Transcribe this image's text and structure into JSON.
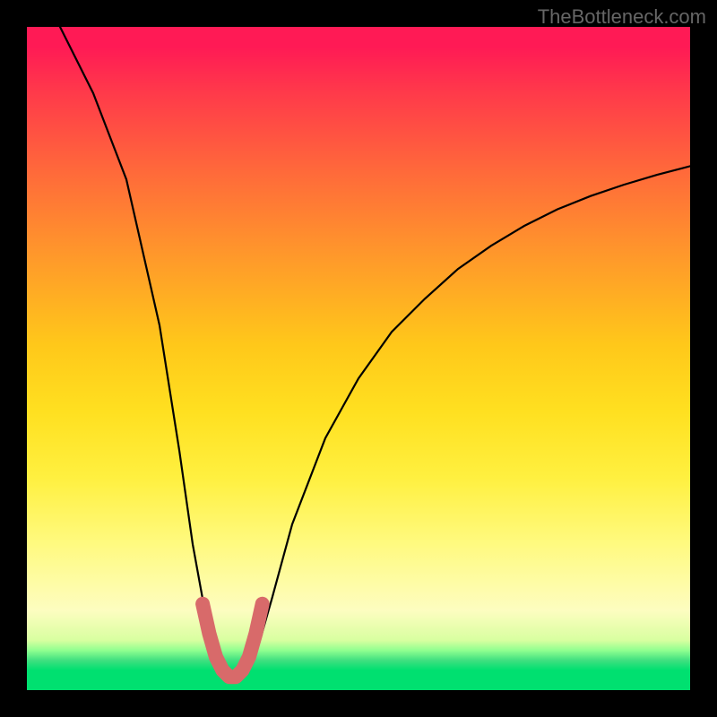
{
  "watermark": "TheBottleneck.com",
  "chart_data": {
    "type": "line",
    "title": "",
    "xlabel": "",
    "ylabel": "",
    "xlim": [
      0,
      100
    ],
    "ylim": [
      0,
      100
    ],
    "series": [
      {
        "name": "bottleneck-curve",
        "x": [
          5,
          10,
          15,
          20,
          23,
          25,
          27,
          28,
          29,
          30,
          31,
          32,
          33,
          34,
          35,
          37,
          40,
          45,
          50,
          55,
          60,
          65,
          70,
          75,
          80,
          85,
          90,
          95,
          100
        ],
        "y": [
          100,
          90,
          77,
          55,
          36,
          22,
          11,
          7,
          4,
          2.5,
          2,
          2,
          2.5,
          4,
          7,
          14,
          25,
          38,
          47,
          54,
          59,
          63.5,
          67,
          70,
          72.5,
          74.5,
          76.2,
          77.7,
          79
        ]
      },
      {
        "name": "highlight-near-minimum",
        "x": [
          26.5,
          27.5,
          28.5,
          29.5,
          30.5,
          31.5,
          32.5,
          33.5,
          34.5,
          35.5
        ],
        "y": [
          13,
          8.5,
          5,
          3,
          2,
          2,
          3,
          5,
          8.5,
          13
        ]
      }
    ],
    "minimum_x": 31,
    "minimum_y": 2,
    "gradient_stops": [
      {
        "pos": 0,
        "color": "#ff1a55"
      },
      {
        "pos": 50,
        "color": "#ffd020"
      },
      {
        "pos": 90,
        "color": "#fdfdc0"
      },
      {
        "pos": 100,
        "color": "#00e070"
      }
    ]
  }
}
